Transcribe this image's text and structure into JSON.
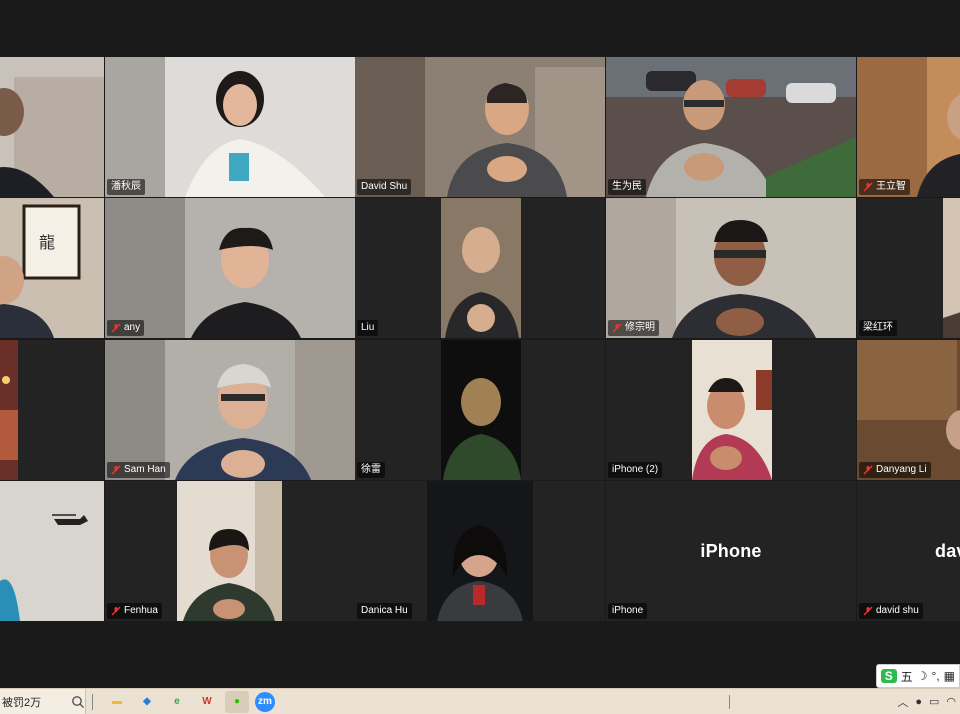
{
  "participants": [
    {
      "label": "",
      "muted": false
    },
    {
      "label": "潘秋辰",
      "muted": false
    },
    {
      "label": "David Shu",
      "muted": false
    },
    {
      "label": "生为民",
      "muted": false
    },
    {
      "label": "王立智",
      "muted": true
    },
    {
      "label": "",
      "muted": false
    },
    {
      "label": "any",
      "muted": true
    },
    {
      "label": "Liu",
      "muted": false
    },
    {
      "label": "修宗明",
      "muted": true
    },
    {
      "label": "梁红环",
      "muted": false
    },
    {
      "label": "",
      "muted": false
    },
    {
      "label": "Sam Han",
      "muted": true
    },
    {
      "label": "徐雷",
      "muted": false
    },
    {
      "label": "iPhone (2)",
      "muted": false
    },
    {
      "label": "Danyang Li",
      "muted": true
    },
    {
      "label": "",
      "muted": false
    },
    {
      "label": "Fenhua",
      "muted": true
    },
    {
      "label": "Danica Hu",
      "muted": false
    },
    {
      "label": "iPhone",
      "muted": false
    },
    {
      "label": "david shu",
      "muted": true
    }
  ],
  "big_names": {
    "iphone": "iPhone",
    "david": "dav"
  },
  "taskbar": {
    "search_text": "被罚2万",
    "apps": [
      {
        "name": "file-explorer-icon",
        "glyph": "▬",
        "color": "#f0b93a"
      },
      {
        "name": "store-icon",
        "glyph": "◆",
        "color": "#2a7fd4"
      },
      {
        "name": "browser-icon",
        "glyph": "e",
        "color": "#2aa84a"
      },
      {
        "name": "wps-icon",
        "glyph": "W",
        "color": "#d9302c"
      },
      {
        "name": "wechat-icon",
        "glyph": "●",
        "color": "#2dc100"
      },
      {
        "name": "zoom-icon",
        "glyph": "zm",
        "color": "#2d8cff"
      }
    ]
  },
  "ime": {
    "logo": "S",
    "mode": "五",
    "moon": "☽",
    "punct": "°,",
    "kbd": "▦"
  }
}
